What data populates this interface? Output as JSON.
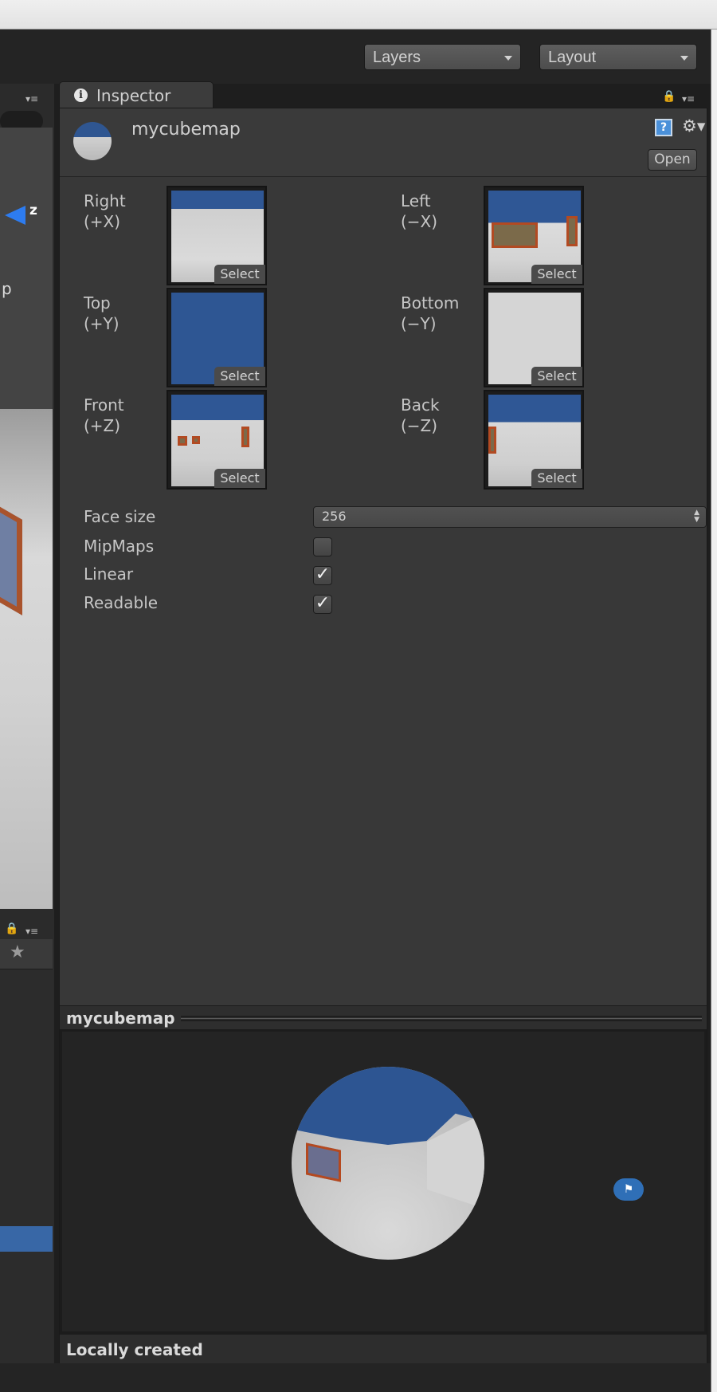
{
  "toolbar": {
    "layers_label": "Layers",
    "layout_label": "Layout"
  },
  "scene": {
    "axis_label": "z",
    "partial_text": "p"
  },
  "inspector": {
    "tab_label": "Inspector",
    "asset_name": "mycubemap",
    "open_label": "Open",
    "help_glyph": "?",
    "faces": [
      {
        "name": "Right",
        "axis": "(+X)",
        "select": "Select"
      },
      {
        "name": "Left",
        "axis": "(−X)",
        "select": "Select"
      },
      {
        "name": "Top",
        "axis": "(+Y)",
        "select": "Select"
      },
      {
        "name": "Bottom",
        "axis": "(−Y)",
        "select": "Select"
      },
      {
        "name": "Front",
        "axis": "(+Z)",
        "select": "Select"
      },
      {
        "name": "Back",
        "axis": "(−Z)",
        "select": "Select"
      }
    ],
    "properties": {
      "face_size_label": "Face size",
      "face_size_value": "256",
      "mipmaps_label": "MipMaps",
      "mipmaps_checked": false,
      "linear_label": "Linear",
      "linear_checked": true,
      "readable_label": "Readable",
      "readable_checked": true
    },
    "preview": {
      "title": "mycubemap"
    },
    "status_text": "Locally created"
  },
  "colors": {
    "sky_blue": "#2e5693",
    "selection_blue": "#3867a6",
    "panel_bg": "#383838"
  },
  "icons": [
    "info-icon",
    "lock-icon",
    "menu-icon",
    "help-icon",
    "gear-icon",
    "star-icon",
    "tag-icon",
    "dropdown-arrow-icon"
  ]
}
